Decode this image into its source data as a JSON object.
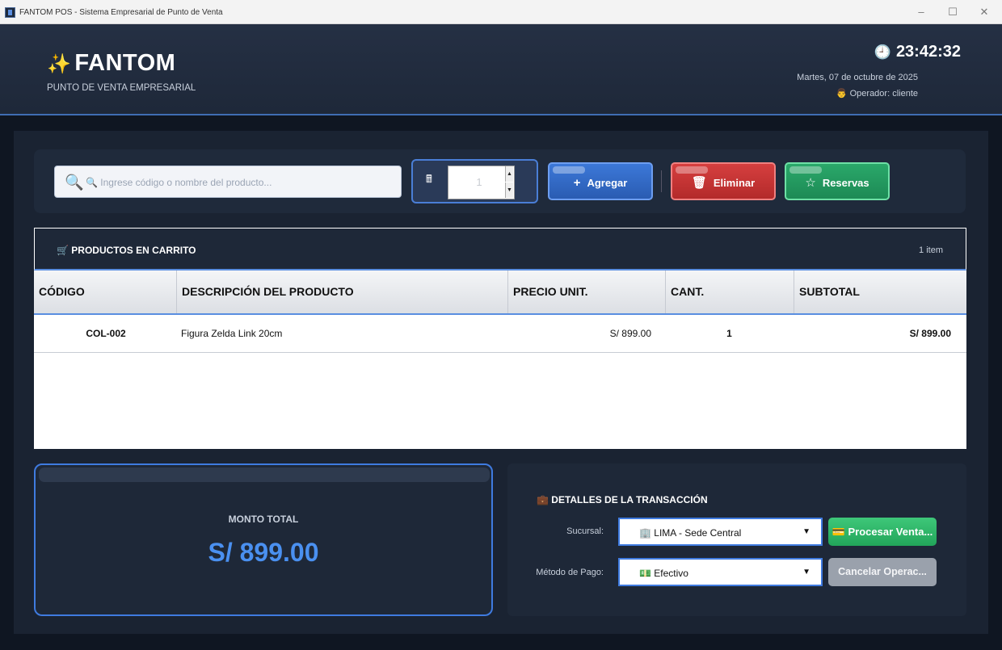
{
  "window": {
    "title": "FANTOM POS - Sistema Empresarial de Punto de Venta",
    "minimize": "–",
    "maximize": "☐",
    "close": "✕"
  },
  "header": {
    "brand_icon": "✨",
    "brand": "FANTOM",
    "subtitle": "PUNTO DE VENTA EMPRESARIAL",
    "clock_icon": "🕘",
    "time": "23:42:32",
    "date": "Martes, 07 de octubre de 2025",
    "operator": "👨 Operador: cliente"
  },
  "toolbar": {
    "search_icon": "🔍",
    "search_placeholder": "🔍 Ingrese código o nombre del producto...",
    "calc_icon": "🖩",
    "quantity": "1",
    "spin_up": "▲",
    "spin_down": "▼",
    "add_icon": "+",
    "add_label": "Agregar",
    "delete_icon": "🗑",
    "delete_label": "Eliminar",
    "reserve_icon": "☆",
    "reserve_label": "Reservas"
  },
  "cart": {
    "title": "🛒 PRODUCTOS EN CARRITO",
    "count": "1 item",
    "columns": [
      "CÓDIGO",
      "DESCRIPCIÓN DEL PRODUCTO",
      "PRECIO UNIT.",
      "CANT.",
      "SUBTOTAL"
    ],
    "rows": [
      {
        "code": "COL-002",
        "description": "Figura Zelda Link 20cm",
        "unit_price": "S/ 899.00",
        "qty": "1",
        "subtotal": "S/ 899.00"
      }
    ]
  },
  "total": {
    "label": "MONTO TOTAL",
    "value": "S/ 899.00"
  },
  "details": {
    "title": "💼 DETALLES DE LA TRANSACCIÓN",
    "branch_label": "Sucursal:",
    "branch_value": "🏢 LIMA - Sede Central",
    "payment_label": "Método de Pago:",
    "payment_value": "💵 Efectivo",
    "select_arrow": "▼",
    "process_label": "💳 Procesar Venta...",
    "cancel_label": "Cancelar Operac..."
  },
  "colors": {
    "accent": "#3f7be0",
    "add": "#3c78d8",
    "delete": "#d63f3f",
    "reserve": "#2aa86a",
    "total_value": "#4a90f0"
  }
}
